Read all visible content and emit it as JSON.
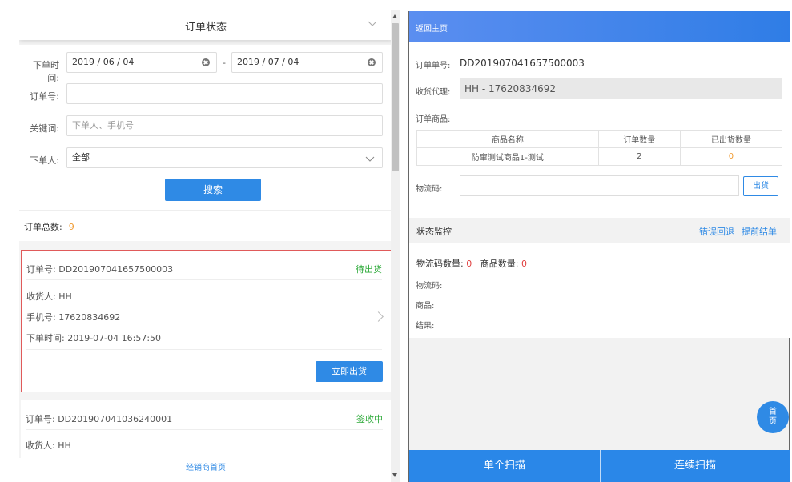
{
  "left": {
    "header_title": "订单状态",
    "filters": {
      "order_time_label": "下单时间:",
      "date_start": "2019 / 06 / 04",
      "date_separator": "-",
      "date_end": "2019 / 07 / 04",
      "order_no_label": "订单号:",
      "order_no_value": "",
      "keyword_label": "关键词:",
      "keyword_placeholder": "下单人、手机号",
      "orderer_label": "下单人:",
      "orderer_value": "全部",
      "search_label": "搜索"
    },
    "total_label": "订单总数:",
    "total_value": "9",
    "orders": [
      {
        "order_no": "订单号: DD201907041657500003",
        "status": "待出货",
        "status_color": "#2eaa3a",
        "receiver": "收货人: HH",
        "phone": "手机号: 17620834692",
        "time": "下单时间: 2019-07-04 16:57:50",
        "action": "立即出货"
      },
      {
        "order_no": "订单号: DD201907041036240001",
        "status": "签收中",
        "status_color": "#2eaa3a",
        "receiver": "收货人: HH"
      }
    ],
    "footer_link": "经销商首页"
  },
  "right": {
    "back_label": "返回主页",
    "order_no_label": "订单单号:",
    "order_no_value": "DD201907041657500003",
    "agent_label": "收货代理:",
    "agent_value": "HH - 17620834692",
    "goods_label": "订单商品:",
    "goods_table": {
      "headers": [
        "商品名称",
        "订单数量",
        "已出货数量"
      ],
      "rows": [
        [
          "防窜测试商品1-测试",
          "2",
          "0"
        ]
      ]
    },
    "logistics_label": "物流码:",
    "ship_button": "出货",
    "monitor": {
      "title": "状态监控",
      "error_rollback": "错误回退",
      "early_close": "提前结单",
      "code_count_label": "物流码数量:",
      "code_count_value": "0",
      "goods_count_label": "商品数量:",
      "goods_count_value": "0",
      "code_label": "物流码:",
      "goods_label": "商品:",
      "result_label": "结果:"
    },
    "fab_label": "首页",
    "single_scan": "单个扫描",
    "continuous_scan": "连续扫描"
  },
  "colors": {
    "accent": "#2f8ae5",
    "orange": "#f09a30",
    "red": "#e04040",
    "green": "#2eaa3a"
  }
}
